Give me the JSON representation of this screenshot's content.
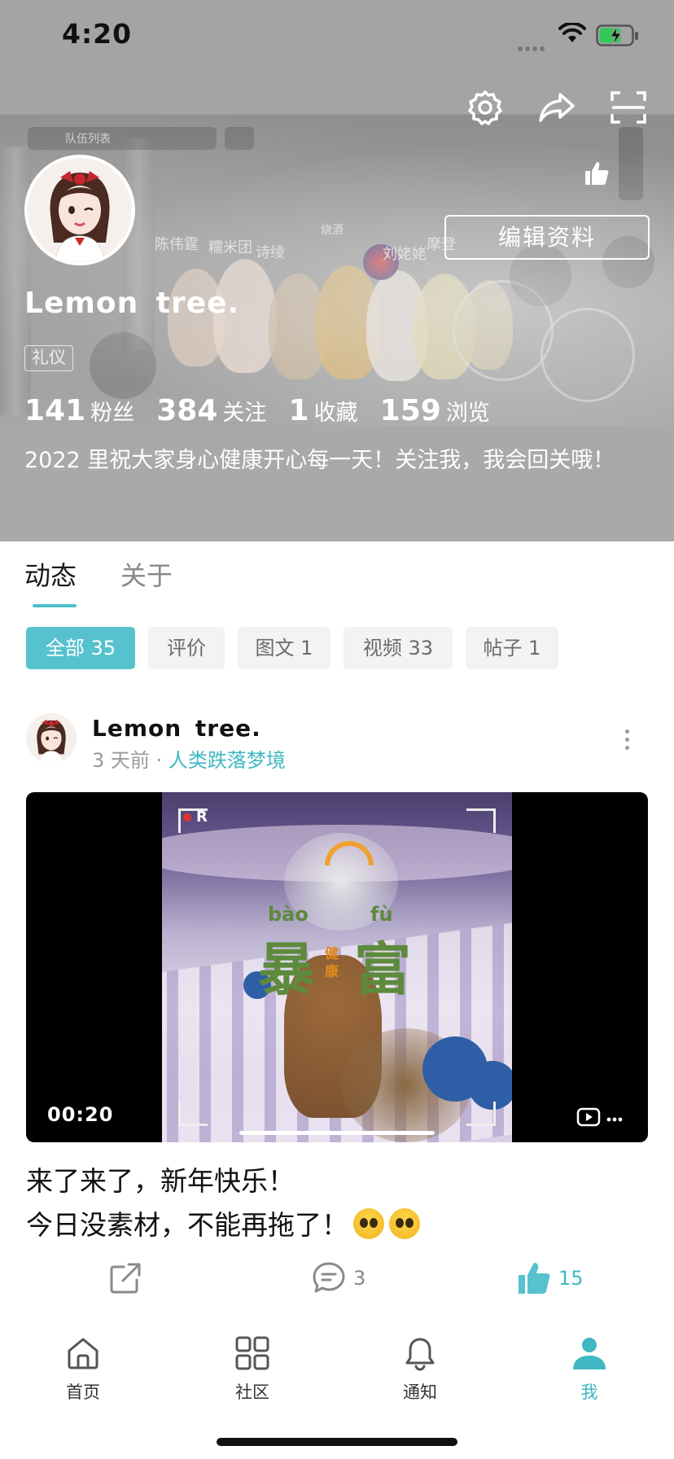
{
  "status_bar": {
    "time": "4:20"
  },
  "profile": {
    "name": "Lemon  tree.",
    "tag": "礼仪",
    "edit_label": "编辑资料",
    "bio": "2022 里祝大家身心健康开心每一天！关注我，我会回关哦！",
    "stats": [
      {
        "value": "141",
        "label": "粉丝"
      },
      {
        "value": "384",
        "label": "关注"
      },
      {
        "value": "1",
        "label": "收藏"
      },
      {
        "value": "159",
        "label": "浏览"
      }
    ],
    "background_labels": [
      "队伍列表",
      "陈伟霆",
      "糯米团",
      "诗绫",
      "烧酒",
      "刘姥姥",
      "摩登"
    ]
  },
  "tabs": [
    {
      "label": "动态",
      "active": true
    },
    {
      "label": "关于",
      "active": false
    }
  ],
  "filters": [
    {
      "label": "全部 35",
      "active": true
    },
    {
      "label": "评价",
      "active": false
    },
    {
      "label": "图文 1",
      "active": false
    },
    {
      "label": "视频 33",
      "active": false
    },
    {
      "label": "帖子 1",
      "active": false
    }
  ],
  "post": {
    "author": "Lemon  tree.",
    "time_ago": "3 天前",
    "separator": "·",
    "topic": "人类跌落梦境",
    "video": {
      "duration": "00:20",
      "overlay_pinyin_left": "bào",
      "overlay_pinyin_right": "fù",
      "overlay_big_left": "暴",
      "overlay_big_right": "富",
      "overlay_small": "健康",
      "overlay_rec": "R"
    },
    "caption_lines": [
      "来了来了，新年快乐！",
      "今日没素材，不能再拖了！"
    ],
    "comment_count": "3",
    "like_count": "15"
  },
  "bottom_nav": [
    {
      "label": "首页",
      "icon": "home-icon",
      "active": false
    },
    {
      "label": "社区",
      "icon": "grid-icon",
      "active": false
    },
    {
      "label": "通知",
      "icon": "bell-icon",
      "active": false
    },
    {
      "label": "我",
      "icon": "person-icon",
      "active": true
    }
  ],
  "colors": {
    "accent": "#56c2cd",
    "accent_text": "#3fb8c4",
    "banner_overlay": "#a4a4a4"
  }
}
